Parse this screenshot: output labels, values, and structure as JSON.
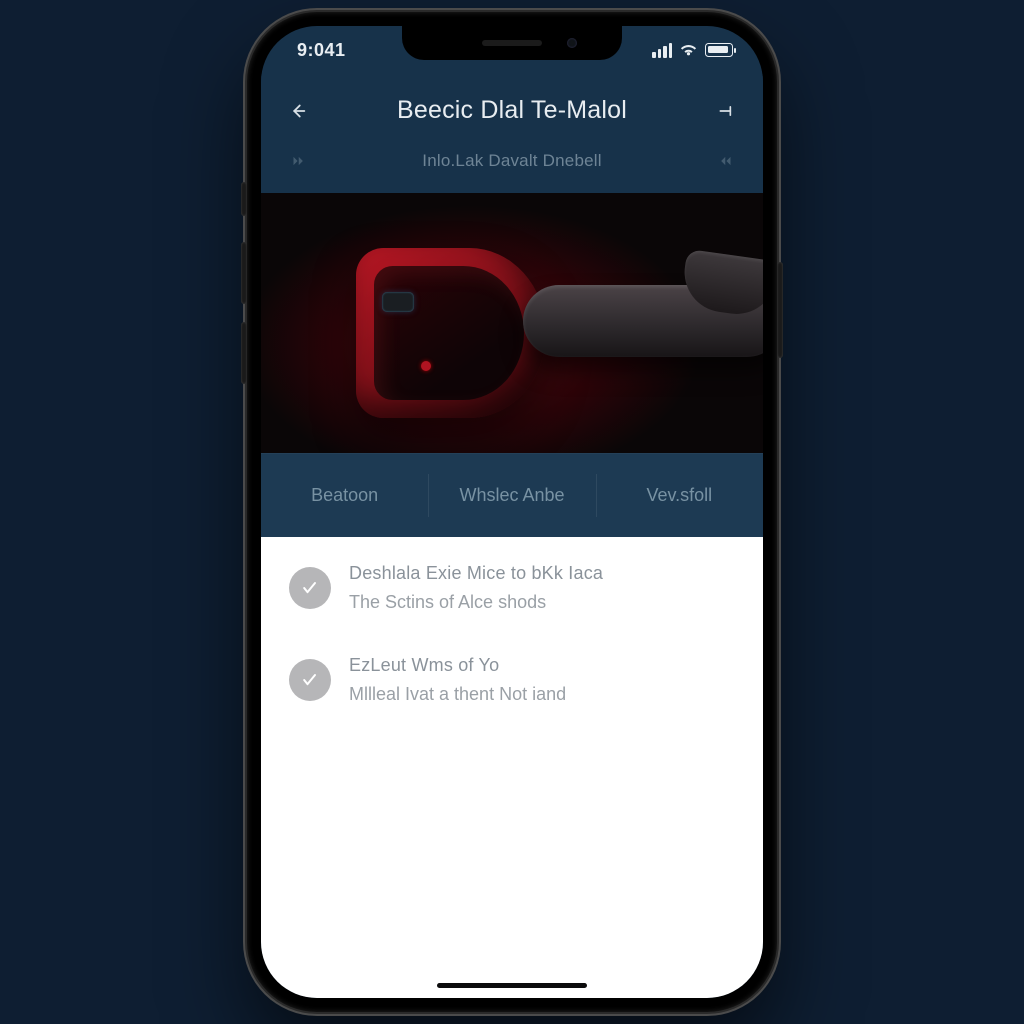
{
  "status": {
    "time": "9:041",
    "icons": {
      "signal": "signal-icon",
      "wifi": "wifi-icon",
      "battery": "battery-icon"
    }
  },
  "header": {
    "back_icon": "arrow-left",
    "title": "Beecic Dlal Te-Malol",
    "right_icon": "bracket-right"
  },
  "subheader": {
    "left_icon": "skip-forward-small",
    "text": "Inlo.Lak Davalt Dnebell",
    "right_icon": "skip-back-small"
  },
  "hero": {
    "alt": "product-render"
  },
  "tabs": [
    {
      "label": "Beatoon"
    },
    {
      "label": "Whslec Anbe"
    },
    {
      "label": "Vev.sfoll"
    }
  ],
  "list": [
    {
      "icon": "check",
      "title": "Deshlala Exie Mice to bKk Iaca",
      "subtitle": "The Sctins of Alce shods"
    },
    {
      "icon": "check",
      "title": "EzLeut Wms of Yo",
      "subtitle": "Mllleal Ivat a thent Not iand"
    }
  ],
  "colors": {
    "bg_dark": "#17324a",
    "bg_page": "#0e1e32",
    "accent_red": "#b91724",
    "tab_bg": "#1d3a53",
    "muted": "#7892a3"
  }
}
